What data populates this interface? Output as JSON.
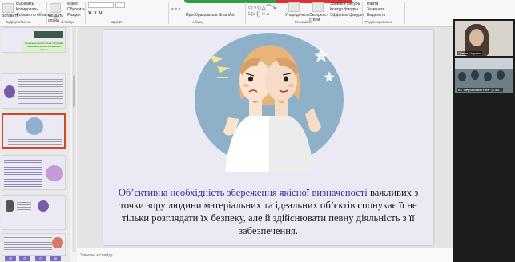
{
  "ribbon": {
    "clipboard": {
      "cut": "Вырезать",
      "copy": "Копировать",
      "paste": "Вставить",
      "format": "Формат по образцу",
      "group": "Буфер обмена"
    },
    "slides": {
      "new": "Создать слайд",
      "layout": "Макет",
      "reset": "Сбросить",
      "section": "Раздел",
      "group": "Слайды"
    },
    "font": {
      "group": "Шрифт"
    },
    "paragraph": {
      "smartart": "Преобразовать в SmartArt",
      "group": "Абзац"
    },
    "drawing": {
      "arrange": "Упорядочить",
      "styles": "Экспресс-стили",
      "fill": "Заливка фигуры",
      "outline": "Контур фигуры",
      "effects": "Эффекты фигуры",
      "group": "Рисование"
    },
    "editing": {
      "find": "Найти",
      "replace": "Заменить",
      "select": "Выделить",
      "group": "Редактирование"
    }
  },
  "thumbnails": [
    {
      "num": "",
      "text": "Соціально-психологічна підтримка заснована на мові вибаченної відпоні"
    },
    {
      "num": "",
      "text": ""
    },
    {
      "num": "",
      "text": ""
    },
    {
      "num": "",
      "text": ""
    },
    {
      "num": "",
      "text": ""
    },
    {
      "num": "",
      "text": ""
    }
  ],
  "slide": {
    "highlight": "Об’єктивна необхідність збереження якісної визначеності",
    "rest": " важливих з точки зору людини матеріальних та ідеальних об’єктів спонукає її не тільки розглядати їх безпеку, але й здійснювати певну діяльність з її забезпечення."
  },
  "notes": {
    "placeholder": "Заметки к слайду"
  },
  "video": {
    "tiles": [
      {
        "name": "Олена Шаулюк"
      },
      {
        "name": "КЗ \"Вербівський НВК\" (з 5 к..."
      }
    ]
  },
  "colors": {
    "accent": "#d24726",
    "slide_bg": "#ebe9f4",
    "highlight_text": "#2e3191",
    "circle": "#8fb0c9"
  }
}
